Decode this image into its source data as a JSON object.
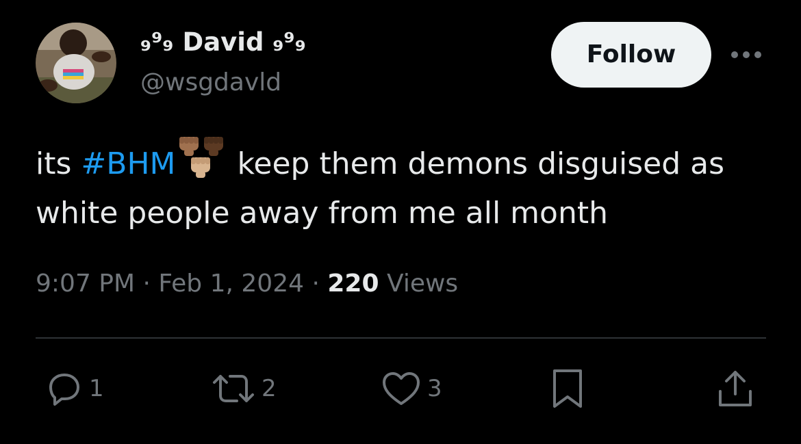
{
  "author": {
    "display_name": "₉⁹₉ David ₉⁹₉",
    "handle": "@wsgdavld",
    "avatar_icon": "profile-photo"
  },
  "header": {
    "follow_label": "Follow",
    "more_icon": "ellipsis-icon"
  },
  "tweet": {
    "text_before": "its ",
    "hashtag": "#BHM",
    "emoji": "three raised fists (brown, dark brown, light brown)",
    "text_after": " keep them demons disguised as white people away from me all month"
  },
  "meta": {
    "time": "9:07 PM",
    "separator": "·",
    "date": "Feb 1, 2024",
    "views_count": "220",
    "views_label": "Views"
  },
  "actions": {
    "replies": "1",
    "reposts": "2",
    "likes": "3"
  },
  "colors": {
    "background": "#000000",
    "text_primary": "#e7e9ea",
    "text_secondary": "#71767b",
    "link": "#1d9bf0",
    "follow_bg": "#eff3f4",
    "divider": "#2f3336"
  }
}
